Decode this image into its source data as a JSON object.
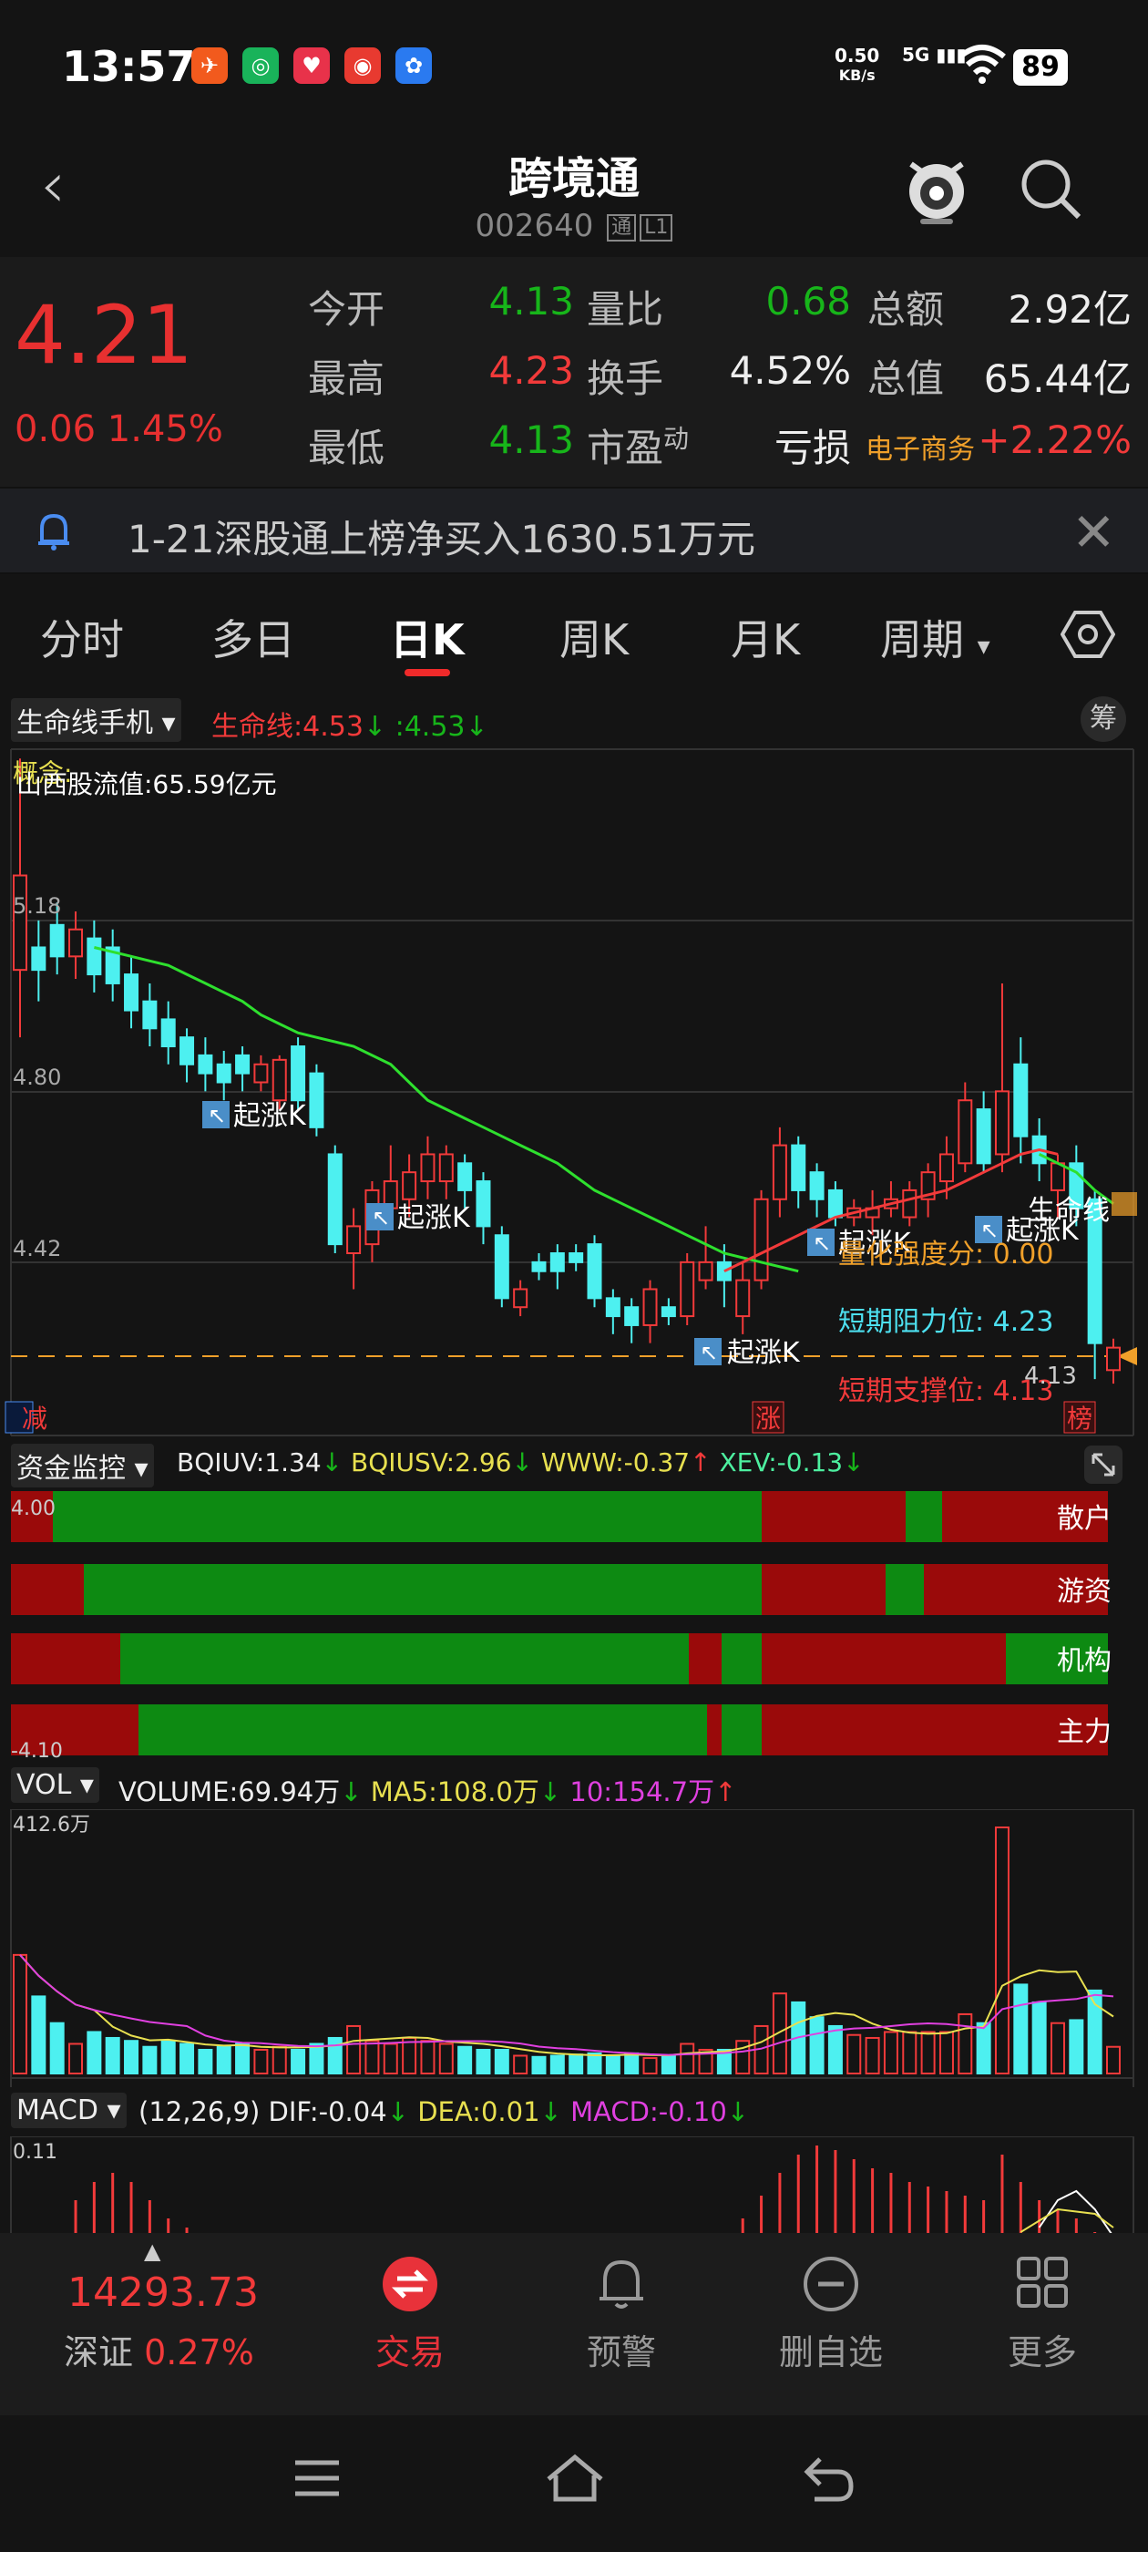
{
  "status": {
    "time": "13:57",
    "net_speed": "0.50",
    "net_unit": "KB/s",
    "signal": "5G",
    "battery": "89"
  },
  "header": {
    "title": "跨境通",
    "code": "002640",
    "tag_tong": "通",
    "tag_level": "L1"
  },
  "quote": {
    "price": "4.21",
    "change": "0.06",
    "change_pct": "1.45%",
    "rows": [
      {
        "k1": "今开",
        "v1": "4.13",
        "k2": "量比",
        "v2": "0.68",
        "k3": "总额",
        "v3": "2.92亿"
      },
      {
        "k1": "最高",
        "v1": "4.23",
        "k2": "换手",
        "v2": "4.52%",
        "k3": "总值",
        "v3": "65.44亿"
      },
      {
        "k1": "最低",
        "v1": "4.13",
        "k2": "市盈",
        "k2sup": "动",
        "v2": "亏损",
        "k3": "电子商务",
        "v3": "+2.22%"
      }
    ]
  },
  "notice": {
    "text": "1-21深股通上榜净买入1630.51万元"
  },
  "tabs": [
    "分时",
    "多日",
    "日K",
    "周K",
    "月K",
    "周期"
  ],
  "main_chart": {
    "indicator_name": "生命线手机",
    "indicator_text": "生命线:4.53",
    "indicator_val2": ":4.53",
    "chou": "筹",
    "overlay_top": "概念:",
    "overlay_line": "山西股流值:65.59亿元",
    "axis": [
      "5.18",
      "4.80",
      "4.42"
    ],
    "qizhang": "起涨K",
    "lifeline_label": "生命线",
    "strength": "量化强度分: 0.00",
    "resist": "短期阻力位: 4.23",
    "support": "短期支撑位: 4.13",
    "last_price_label": "4.13",
    "bang": "榜",
    "zhang": "涨",
    "jian": "减"
  },
  "capital": {
    "name": "资金监控",
    "bqiuv": "BQIUV:1.34",
    "bqiusv": "BQIUSV:2.96",
    "www": "WWW:-0.37",
    "xev": "XEV:-0.13",
    "top": "4.00",
    "bottom": "-4.10",
    "rows": [
      "散户",
      "游资",
      "机构",
      "主力"
    ]
  },
  "volume": {
    "name": "VOL",
    "volume": "VOLUME:69.94万",
    "ma5": "MA5:108.0万",
    "ma10": "10:154.7万",
    "max": "412.6万"
  },
  "macd": {
    "name": "MACD",
    "params": "(12,26,9)",
    "dif": "DIF:-0.04",
    "dea": "DEA:0.01",
    "macd": "MACD:-0.10",
    "max": "0.11"
  },
  "bottom": {
    "index_value": "14293.73",
    "index_name": "深证",
    "index_pct": "0.27%",
    "items": [
      "交易",
      "预警",
      "删自选",
      "更多"
    ]
  },
  "colors": {
    "up": "#f23a3a",
    "down": "#4df0f0",
    "green_fill": "#0d8a12",
    "red_fill": "#9a0a0a"
  }
}
